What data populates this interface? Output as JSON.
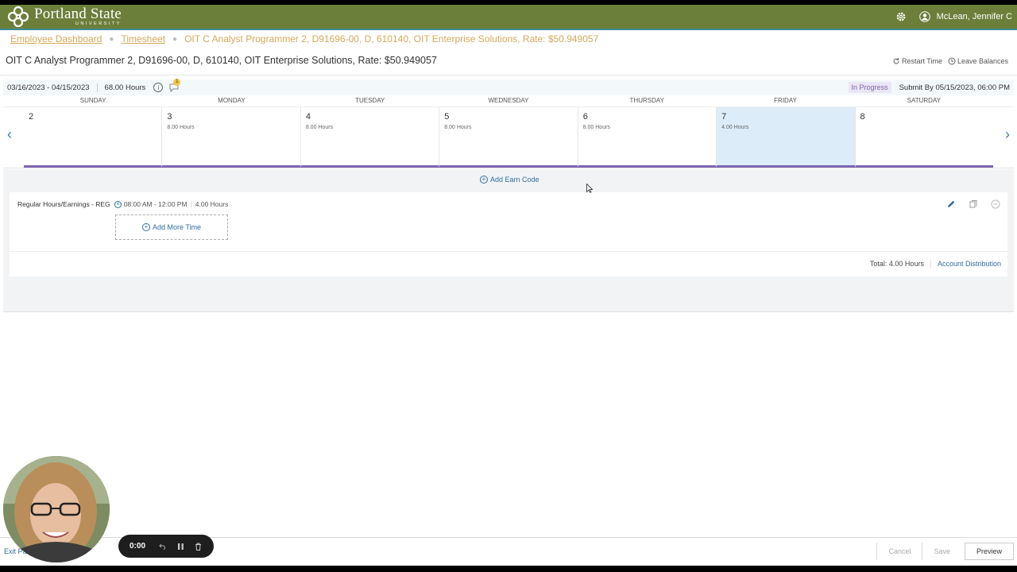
{
  "header": {
    "logo_title": "Portland State",
    "logo_sub": "UNIVERSITY",
    "user_name": "McLean, Jennifer C",
    "icons": [
      "gear-icon",
      "user-icon"
    ],
    "bar_color": "#6b7f3a"
  },
  "breadcrumb": {
    "items": [
      "Employee Dashboard",
      "Timesheet"
    ],
    "current": "OIT C Analyst Programmer 2, D91696-00, D, 610140, OIT Enterprise Solutions, Rate: $50.949057"
  },
  "page": {
    "title": "OIT C Analyst Programmer 2, D91696-00, D, 610140, OIT Enterprise Solutions, Rate: $50.949057",
    "restart_time": "Restart Time",
    "leave_balances": "Leave Balances"
  },
  "period": {
    "dates": "03/16/2023 - 04/15/2023",
    "hours": "68.00 Hours",
    "comment_count": "1",
    "status": "In Progress",
    "submit_by": "Submit By 05/15/2023, 06:00 PM"
  },
  "calendar": {
    "day_names": [
      "SUNDAY",
      "MONDAY",
      "TUESDAY",
      "WEDNESDAY",
      "THURSDAY",
      "FRIDAY",
      "SATURDAY"
    ],
    "days": [
      {
        "num": "2",
        "hours": ""
      },
      {
        "num": "3",
        "hours": "8.00 Hours"
      },
      {
        "num": "4",
        "hours": "8.00 Hours"
      },
      {
        "num": "5",
        "hours": "8.00 Hours"
      },
      {
        "num": "6",
        "hours": "8.00 Hours"
      },
      {
        "num": "7",
        "hours": "4.00 Hours"
      },
      {
        "num": "8",
        "hours": ""
      }
    ],
    "selected_day": "7"
  },
  "earn": {
    "add_earn_code": "Add Earn Code",
    "entry_label": "Regular Hours/Earnings - REG",
    "entry_time": "08:00 AM - 12:00 PM",
    "entry_hours": "4.00 Hours",
    "add_more_time": "Add More Time",
    "total": "Total: 4.00 Hours",
    "account_distribution": "Account Distribution"
  },
  "footer": {
    "exit": "Exit Pa",
    "cancel": "Cancel",
    "save": "Save",
    "preview": "Preview"
  },
  "recorder": {
    "time": "0:00"
  }
}
